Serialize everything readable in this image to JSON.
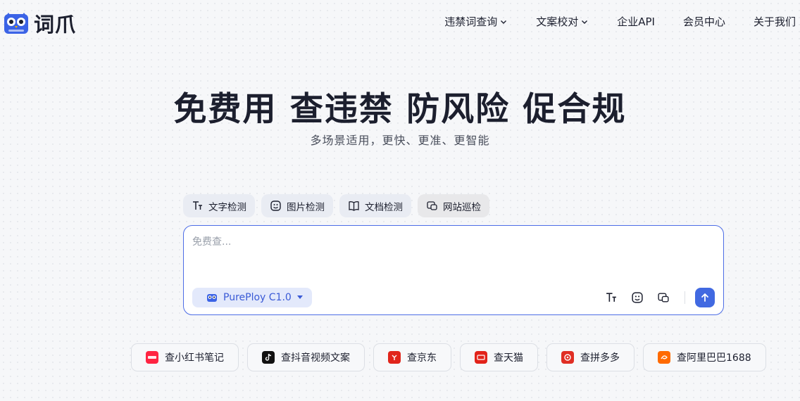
{
  "header": {
    "logo_text": "词爪",
    "nav": [
      {
        "label": "违禁词查询",
        "has_dropdown": true
      },
      {
        "label": "文案校对",
        "has_dropdown": true
      },
      {
        "label": "企业API",
        "has_dropdown": false
      },
      {
        "label": "会员中心",
        "has_dropdown": false
      },
      {
        "label": "关于我们",
        "has_dropdown": false
      }
    ]
  },
  "hero": {
    "title": "免费用 查违禁 防风险 促合规",
    "subtitle": "多场景适用，更快、更准、更智能"
  },
  "tabs": [
    {
      "label": "文字检测",
      "icon": "text-icon"
    },
    {
      "label": "图片检测",
      "icon": "image-icon"
    },
    {
      "label": "文档检测",
      "icon": "document-icon"
    },
    {
      "label": "网站巡检",
      "icon": "website-icon"
    }
  ],
  "input": {
    "placeholder": "免费查...",
    "value": "",
    "model": "PurePloy C1.0"
  },
  "platforms": [
    {
      "label": "查小红书笔记",
      "icon": "xiaohongshu-icon",
      "color": "#ff2442"
    },
    {
      "label": "查抖音视频文案",
      "icon": "douyin-icon",
      "color": "#111111"
    },
    {
      "label": "查京东",
      "icon": "jd-icon",
      "color": "#e1251b"
    },
    {
      "label": "查天猫",
      "icon": "tmall-icon",
      "color": "#e2231a"
    },
    {
      "label": "查拼多多",
      "icon": "pinduoduo-icon",
      "color": "#e02e24"
    },
    {
      "label": "查阿里巴巴1688",
      "icon": "alibaba-1688-icon",
      "color": "#ff6a00"
    }
  ],
  "colors": {
    "accent": "#4169e1",
    "text": "#1c1f2e"
  }
}
